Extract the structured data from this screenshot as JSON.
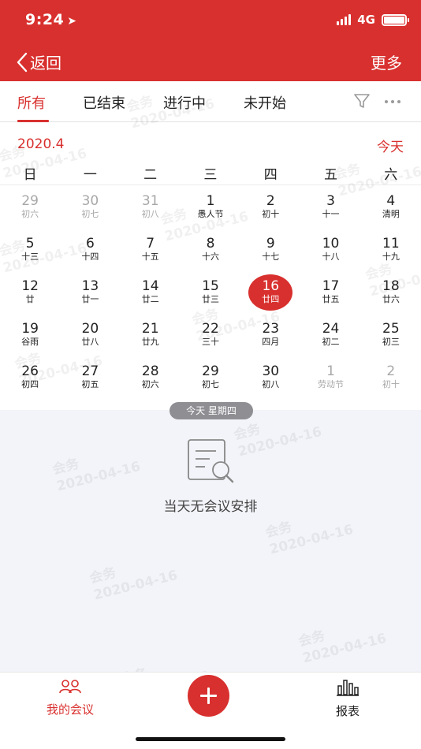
{
  "status_bar": {
    "time": "9:24",
    "network": "4G"
  },
  "nav": {
    "back_label": "返回",
    "more_label": "更多"
  },
  "tabs": [
    {
      "label": "所有",
      "active": true
    },
    {
      "label": "已结束",
      "active": false
    },
    {
      "label": "进行中",
      "active": false
    },
    {
      "label": "未开始",
      "active": false
    }
  ],
  "calendar": {
    "month": "2020.4",
    "today_label": "今天",
    "weekdays": [
      "日",
      "一",
      "二",
      "三",
      "四",
      "五",
      "六"
    ],
    "weeks": [
      [
        {
          "d": "29",
          "l": "初六",
          "other": true
        },
        {
          "d": "30",
          "l": "初七",
          "other": true
        },
        {
          "d": "31",
          "l": "初八",
          "other": true
        },
        {
          "d": "1",
          "l": "愚人节"
        },
        {
          "d": "2",
          "l": "初十"
        },
        {
          "d": "3",
          "l": "十一"
        },
        {
          "d": "4",
          "l": "清明"
        }
      ],
      [
        {
          "d": "5",
          "l": "十三"
        },
        {
          "d": "6",
          "l": "十四"
        },
        {
          "d": "7",
          "l": "十五"
        },
        {
          "d": "8",
          "l": "十六"
        },
        {
          "d": "9",
          "l": "十七"
        },
        {
          "d": "10",
          "l": "十八"
        },
        {
          "d": "11",
          "l": "十九"
        }
      ],
      [
        {
          "d": "12",
          "l": "廿"
        },
        {
          "d": "13",
          "l": "廿一"
        },
        {
          "d": "14",
          "l": "廿二"
        },
        {
          "d": "15",
          "l": "廿三"
        },
        {
          "d": "16",
          "l": "廿四",
          "selected": true
        },
        {
          "d": "17",
          "l": "廿五"
        },
        {
          "d": "18",
          "l": "廿六"
        }
      ],
      [
        {
          "d": "19",
          "l": "谷雨"
        },
        {
          "d": "20",
          "l": "廿八"
        },
        {
          "d": "21",
          "l": "廿九"
        },
        {
          "d": "22",
          "l": "三十"
        },
        {
          "d": "23",
          "l": "四月"
        },
        {
          "d": "24",
          "l": "初二"
        },
        {
          "d": "25",
          "l": "初三"
        }
      ],
      [
        {
          "d": "26",
          "l": "初四"
        },
        {
          "d": "27",
          "l": "初五"
        },
        {
          "d": "28",
          "l": "初六"
        },
        {
          "d": "29",
          "l": "初七"
        },
        {
          "d": "30",
          "l": "初八"
        },
        {
          "d": "1",
          "l": "劳动节",
          "other": true
        },
        {
          "d": "2",
          "l": "初十",
          "other": true
        }
      ]
    ]
  },
  "agenda": {
    "today_pill": "今天 星期四",
    "empty_message": "当天无会议安排"
  },
  "watermark": {
    "line1": "会务",
    "line2": "2020-04-16"
  },
  "bottom_nav": {
    "my_meetings": "我的会议",
    "reports": "报表"
  },
  "colors": {
    "brand": "#d8302e",
    "agenda_bg": "#f3f4f9"
  }
}
